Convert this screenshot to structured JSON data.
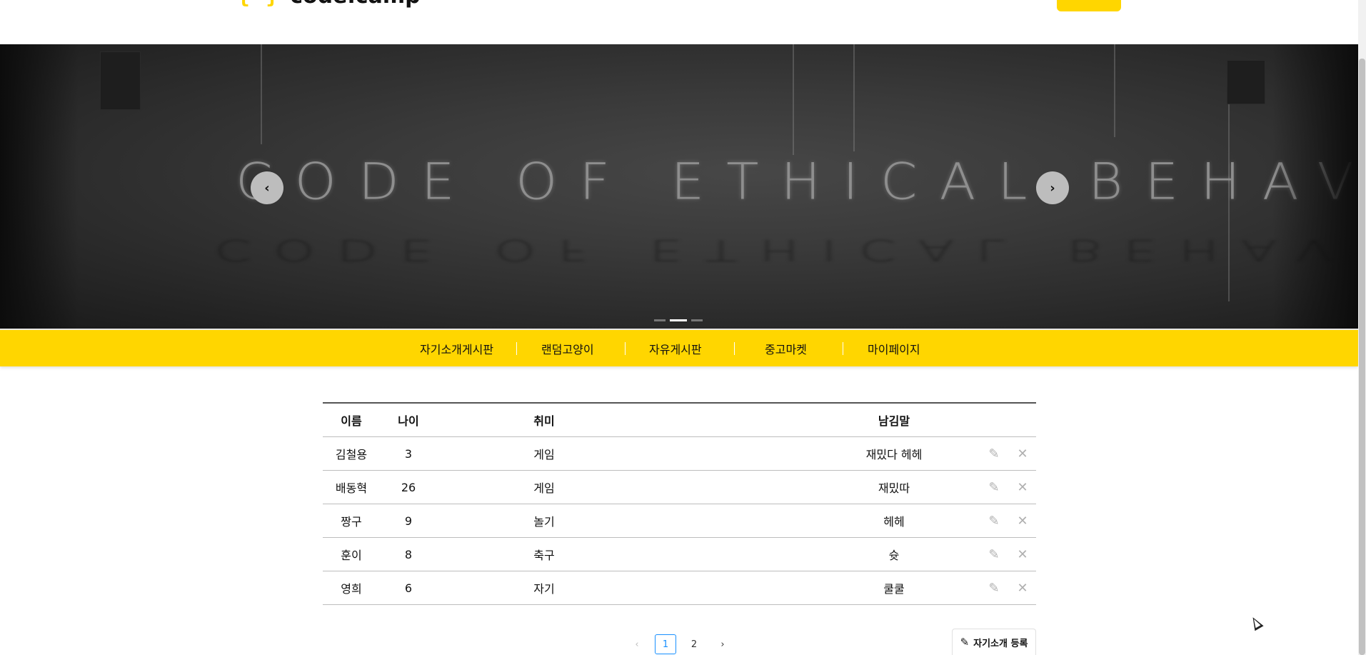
{
  "header": {
    "logo_brace": "{ }",
    "logo_text": "code.camp",
    "link_label": "",
    "button_label": ""
  },
  "banner": {
    "neon_text": "CODE OF ETHICAL BEHAVIOR",
    "prev_icon": "chevron-left-icon",
    "next_icon": "chevron-right-icon",
    "slides": 3,
    "active_slide": 2
  },
  "nav": {
    "items": [
      {
        "label": "자기소개게시판"
      },
      {
        "label": "랜덤고양이"
      },
      {
        "label": "자유게시판"
      },
      {
        "label": "중고마켓"
      },
      {
        "label": "마이페이지"
      }
    ]
  },
  "table": {
    "headers": {
      "name": "이름",
      "age": "나이",
      "hobby": "취미",
      "message": "남김말"
    },
    "rows": [
      {
        "name": "김철용",
        "age": "3",
        "hobby": "게임",
        "message": "재밌다 헤헤"
      },
      {
        "name": "배동혁",
        "age": "26",
        "hobby": "게임",
        "message": "재밌따"
      },
      {
        "name": "짱구",
        "age": "9",
        "hobby": "놀기",
        "message": "헤헤"
      },
      {
        "name": "훈이",
        "age": "8",
        "hobby": "축구",
        "message": "슛"
      },
      {
        "name": "영희",
        "age": "6",
        "hobby": "자기",
        "message": "쿨쿨"
      }
    ],
    "edit_icon": "pencil-icon",
    "delete_icon": "close-icon"
  },
  "pagination": {
    "prev": "‹",
    "pages": [
      "1",
      "2"
    ],
    "current": "1",
    "next": "›"
  },
  "register_button": {
    "label": "자기소개 등록",
    "icon": "pencil-icon"
  },
  "colors": {
    "accent": "#ffd600",
    "page_active": "#1890ff"
  }
}
